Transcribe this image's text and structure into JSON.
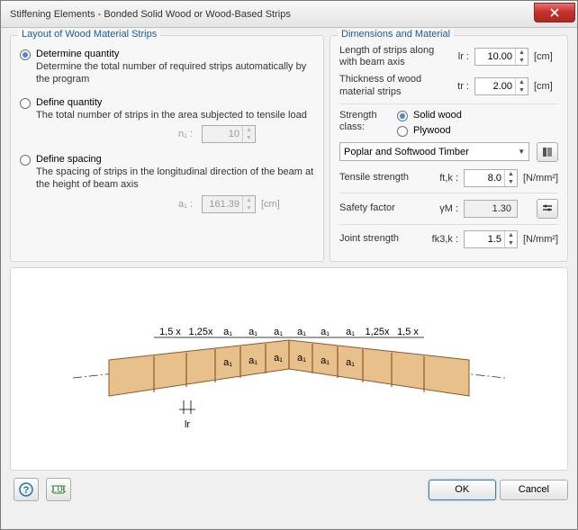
{
  "window": {
    "title": "Stiffening Elements - Bonded Solid Wood or Wood-Based Strips"
  },
  "layout_group": {
    "title": "Layout of Wood Material Strips",
    "opt_determine": {
      "label": "Determine quantity",
      "desc": "Determine the total number of required strips automatically by the program",
      "checked": true
    },
    "opt_define_qty": {
      "label": "Define quantity",
      "desc": "The total number of strips in the area subjected to tensile load",
      "checked": false,
      "sym": "n₁ :",
      "value": "10"
    },
    "opt_define_spacing": {
      "label": "Define spacing",
      "desc": "The spacing of strips in the longitudinal direction of the beam at the height of beam axis",
      "checked": false,
      "sym": "a₁ :",
      "value": "161.39",
      "unit": "[cm]"
    }
  },
  "dim_group": {
    "title": "Dimensions and Material",
    "length": {
      "label": "Length of strips along with beam axis",
      "sym": "lr :",
      "value": "10.00",
      "unit": "[cm]"
    },
    "thickness": {
      "label": "Thickness of wood material strips",
      "sym": "tr :",
      "value": "2.00",
      "unit": "[cm]"
    },
    "strength_class": {
      "label": "Strength class:",
      "solid": "Solid wood",
      "plywood": "Plywood",
      "selected": "solid",
      "dropdown": "Poplar and Softwood Timber"
    },
    "tensile": {
      "label": "Tensile strength",
      "sym": "ft,k :",
      "value": "8.0",
      "unit": "[N/mm²]"
    },
    "safety": {
      "label": "Safety factor",
      "sym": "γM :",
      "value": "1.30"
    },
    "joint": {
      "label": "Joint strength",
      "sym": "fk3,k :",
      "value": "1.5",
      "unit": "[N/mm²]"
    }
  },
  "diagram": {
    "labels": {
      "x15": "1,5 x",
      "x125": "1,25x",
      "a1": "a₁",
      "lr": "lr"
    }
  },
  "buttons": {
    "ok": "OK",
    "cancel": "Cancel"
  }
}
